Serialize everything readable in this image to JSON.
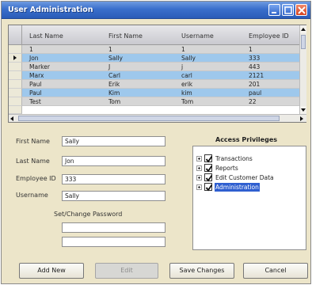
{
  "window": {
    "title": "User Administration"
  },
  "grid": {
    "columns": [
      "Last Name",
      "First Name",
      "Username",
      "Employee ID"
    ],
    "rows": [
      [
        "1",
        "1",
        "1",
        "1"
      ],
      [
        "Jon",
        "Sally",
        "Sally",
        "333"
      ],
      [
        "Marker",
        "J",
        "j",
        "443"
      ],
      [
        "Marx",
        "Carl",
        "carl",
        "2121"
      ],
      [
        "Paul",
        "Erik",
        "erik",
        "201"
      ],
      [
        "Paul",
        "Kim",
        "kim",
        "paul"
      ],
      [
        "Test",
        "Tom",
        "Tom",
        "22"
      ]
    ],
    "current_row": 1
  },
  "form": {
    "first_name_label": "First Name",
    "first_name_value": "Sally",
    "last_name_label": "Last Name",
    "last_name_value": "Jon",
    "employee_id_label": "Employee ID",
    "employee_id_value": "333",
    "username_label": "Username",
    "username_value": "Sally",
    "password_label": "Set/Change Password"
  },
  "privileges": {
    "title": "Access Privileges",
    "items": [
      {
        "label": "Transactions",
        "checked": true,
        "selected": false
      },
      {
        "label": "Reports",
        "checked": true,
        "selected": false
      },
      {
        "label": "Edit Customer Data",
        "checked": true,
        "selected": false
      },
      {
        "label": "Administration",
        "checked": true,
        "selected": true
      }
    ]
  },
  "buttons": {
    "add_new": "Add New",
    "edit": "Edit",
    "save_changes": "Save Changes",
    "cancel": "Cancel"
  },
  "colors": {
    "title_bar": "#3a6fcc",
    "row_highlight": "#9ec8ec",
    "row_alt": "#d6d6d6",
    "tree_selection": "#2f5fd0"
  }
}
